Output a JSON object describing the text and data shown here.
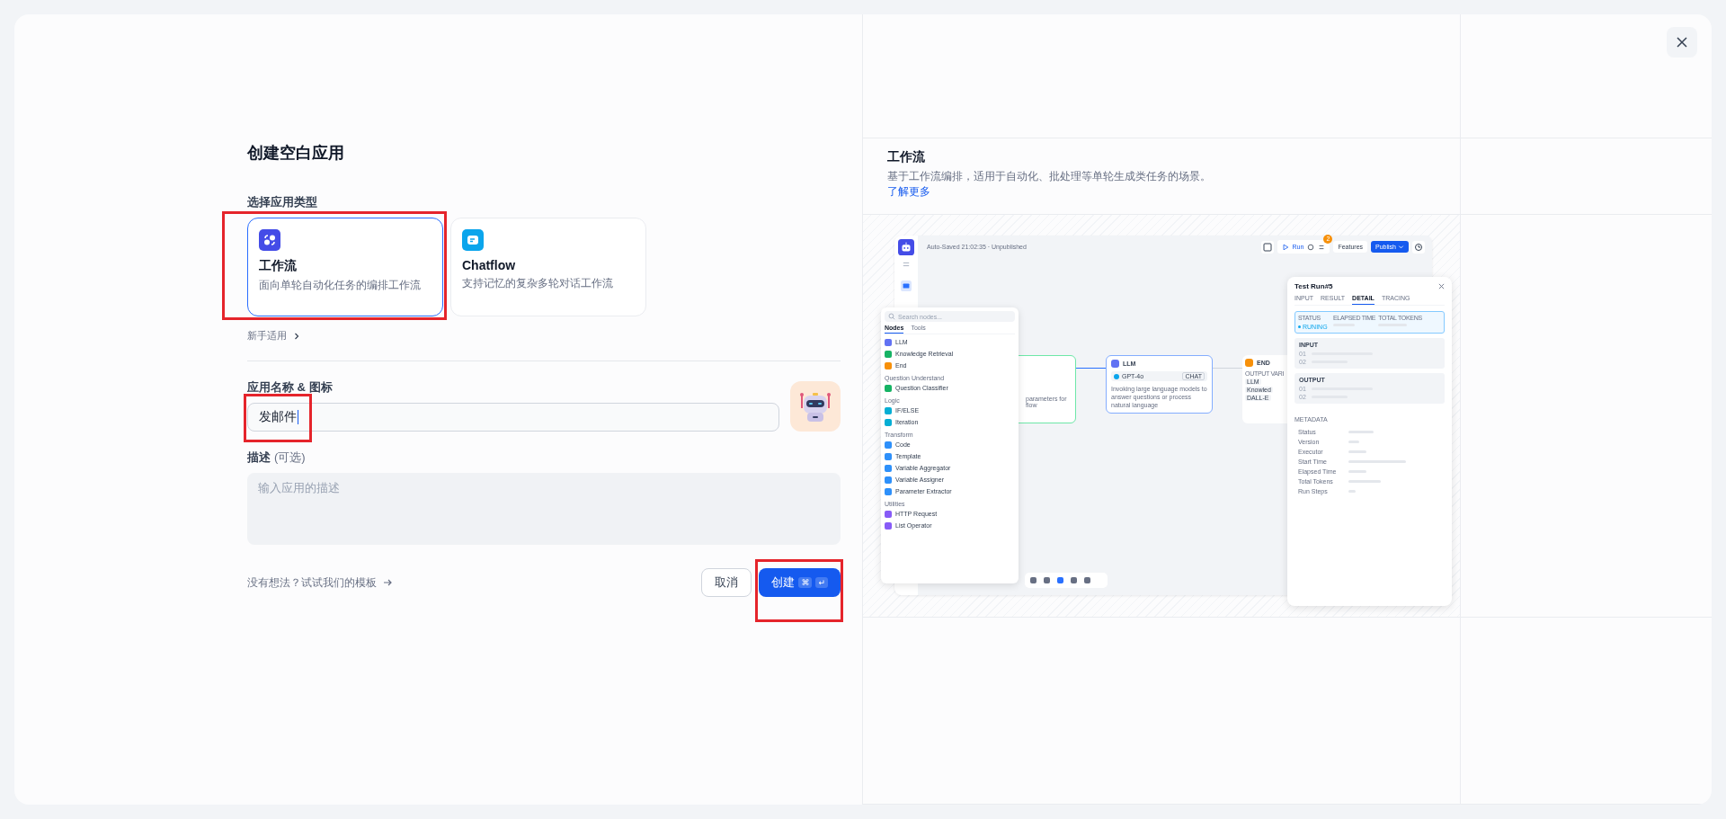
{
  "title": "创建空白应用",
  "type_section": {
    "label": "选择应用类型",
    "hint": "新手适用",
    "options": [
      {
        "kind": "workflow",
        "name": "工作流",
        "description": "面向单轮自动化任务的编排工作流",
        "selected": true,
        "highlighted": true
      },
      {
        "kind": "chatflow",
        "name": "Chatflow",
        "description": "支持记忆的复杂多轮对话工作流",
        "selected": false,
        "highlighted": false
      }
    ]
  },
  "name_section": {
    "label": "应用名称 & 图标",
    "value": "发邮件",
    "highlighted": true
  },
  "description_section": {
    "label": "描述",
    "optional": "(可选)",
    "placeholder": "输入应用的描述"
  },
  "footer": {
    "template_link": "没有想法？试试我们的模板",
    "buttons": [
      {
        "kind": "cancel",
        "label": "取消",
        "highlighted": false
      },
      {
        "kind": "create",
        "label": "创建",
        "keys": [
          "⌘",
          "↵"
        ],
        "highlighted": true
      }
    ]
  },
  "preview": {
    "title": "工作流",
    "description": "基于工作流编排，适用于自动化、批处理等单轮生成类任务的场景。",
    "link": "了解更多",
    "app": {
      "status": "Auto-Saved 21:02:35 · Unpublished",
      "run": "Run",
      "badge": "2",
      "features": "Features",
      "publish": "Publish",
      "palette": {
        "placeholder": "Search nodes...",
        "tabs": [
          {
            "label": "Nodes",
            "selected": true
          },
          {
            "label": "Tools",
            "selected": false
          }
        ],
        "groups": [
          {
            "items": [
              {
                "name": "LLM",
                "color": "#6172f3"
              },
              {
                "name": "Knowledge Retrieval",
                "color": "#16b364"
              },
              {
                "name": "End",
                "color": "#f79009"
              }
            ]
          },
          {
            "title": "Question Understand",
            "items": [
              {
                "name": "Question Classifier",
                "color": "#16b364"
              }
            ]
          },
          {
            "title": "Logic",
            "items": [
              {
                "name": "IF/ELSE",
                "color": "#06aed4"
              },
              {
                "name": "Iteration",
                "color": "#06aed4"
              }
            ]
          },
          {
            "title": "Transform",
            "items": [
              {
                "name": "Code",
                "color": "#2e90fa"
              },
              {
                "name": "Template",
                "color": "#2e90fa"
              },
              {
                "name": "Variable Aggregator",
                "color": "#2e90fa"
              },
              {
                "name": "Variable Assigner",
                "color": "#2e90fa"
              },
              {
                "name": "Parameter Extractor",
                "color": "#2e90fa"
              }
            ]
          },
          {
            "title": "Utilities",
            "items": [
              {
                "name": "HTTP Request",
                "color": "#875bf7"
              },
              {
                "name": "List Operator",
                "color": "#875bf7"
              }
            ]
          }
        ]
      },
      "start_node": {
        "lines": [
          "parameters for",
          "flow"
        ]
      },
      "llm_node": {
        "title": "LLM",
        "model": "GPT-4o",
        "tag": "CHAT",
        "description": "Invoking large language models to answer questions or process natural language"
      },
      "end_node": {
        "title": "END",
        "label": "OUTPUT VARI",
        "rows": [
          "LLM",
          "Knowled",
          "DALL-E"
        ]
      },
      "test_run": {
        "title": "Test Run#5",
        "tabs": [
          {
            "label": "INPUT",
            "selected": false
          },
          {
            "label": "RESULT",
            "selected": false
          },
          {
            "label": "DETAIL",
            "selected": true
          },
          {
            "label": "TRACING",
            "selected": false
          }
        ],
        "status_label": "STATUS",
        "status": "RUNING",
        "elapsed_label": "ELAPSED TIME",
        "tokens_label": "TOTAL TOKENS",
        "sections": [
          {
            "title": "INPUT",
            "rows": [
              "01",
              "02"
            ]
          },
          {
            "title": "OUTPUT",
            "rows": [
              "01",
              "02"
            ]
          }
        ],
        "metadata_title": "METADATA",
        "metadata": [
          "Status",
          "Version",
          "Executor",
          "Start Time",
          "Elapsed Time",
          "Total Tokens",
          "Run Steps"
        ]
      }
    }
  }
}
